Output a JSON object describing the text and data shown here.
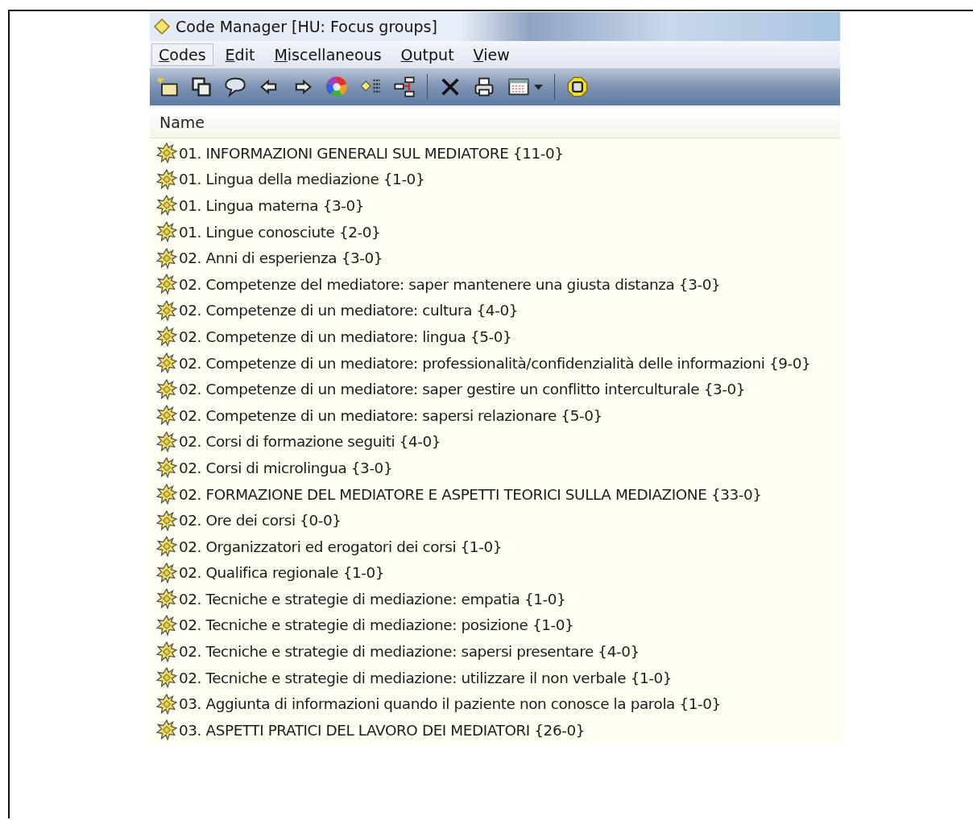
{
  "window": {
    "title": "Code Manager [HU: Focus groups]"
  },
  "menu": [
    {
      "label": "Codes",
      "selected": true
    },
    {
      "label": "Edit",
      "selected": false
    },
    {
      "label": "Miscellaneous",
      "selected": false
    },
    {
      "label": "Output",
      "selected": false
    },
    {
      "label": "View",
      "selected": false
    }
  ],
  "list": {
    "column": "Name",
    "rows": [
      {
        "label": "01. INFORMAZIONI GENERALI SUL MEDIATORE {11-0}"
      },
      {
        "label": "01. Lingua della mediazione {1-0}"
      },
      {
        "label": "01. Lingua materna {3-0}"
      },
      {
        "label": "01. Lingue conosciute {2-0}"
      },
      {
        "label": "02. Anni di esperienza {3-0}"
      },
      {
        "label": "02. Competenze del mediatore: saper mantenere una giusta distanza {3-0}"
      },
      {
        "label": "02. Competenze di un mediatore: cultura {4-0}"
      },
      {
        "label": "02. Competenze di un mediatore: lingua {5-0}"
      },
      {
        "label": "02. Competenze di un mediatore: professionalità/confidenzialità delle informazioni {9-0}"
      },
      {
        "label": "02. Competenze di un mediatore: saper gestire un conflitto interculturale {3-0}"
      },
      {
        "label": "02. Competenze di un mediatore: sapersi relazionare {5-0}"
      },
      {
        "label": "02. Corsi di formazione seguiti {4-0}"
      },
      {
        "label": "02. Corsi di microlingua {3-0}"
      },
      {
        "label": "02. FORMAZIONE DEL MEDIATORE E ASPETTI TEORICI SULLA MEDIAZIONE {33-0}"
      },
      {
        "label": "02. Ore dei corsi {0-0}"
      },
      {
        "label": "02. Organizzatori ed erogatori dei corsi {1-0}"
      },
      {
        "label": "02. Qualifica regionale {1-0}"
      },
      {
        "label": "02. Tecniche e strategie di mediazione: empatia {1-0}"
      },
      {
        "label": "02. Tecniche e strategie di mediazione: posizione {1-0}"
      },
      {
        "label": "02. Tecniche e strategie di mediazione: sapersi presentare {4-0}"
      },
      {
        "label": "02. Tecniche e strategie di mediazione: utilizzare il non verbale {1-0}"
      },
      {
        "label": "03. Aggiunta di informazioni quando il paziente non conosce la parola {1-0}"
      },
      {
        "label": "03. ASPETTI PRATICI DEL LAVORO DEI MEDIATORI {26-0}"
      }
    ]
  }
}
